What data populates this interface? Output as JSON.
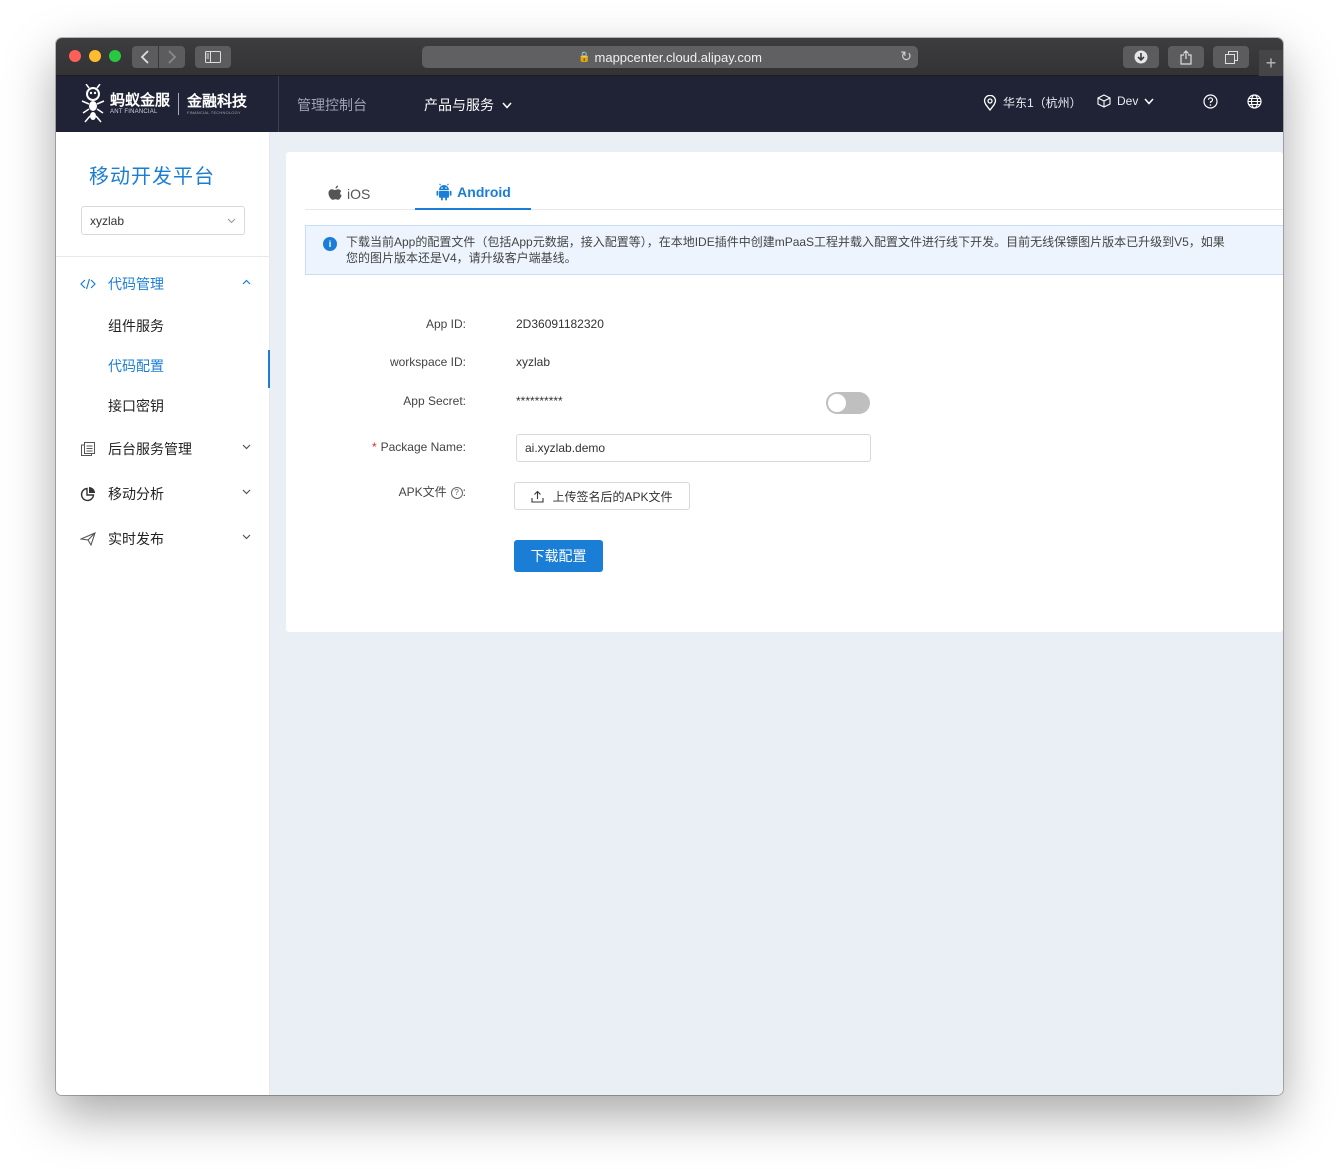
{
  "browser": {
    "url": "mappcenter.cloud.alipay.com"
  },
  "topnav": {
    "logo_brand": "蚂蚁金服",
    "logo_brand_sub": "ANT FINANCIAL",
    "logo_tagline": "金融科技",
    "logo_tagline_sub": "FINANCIAL TECHNOLOGY",
    "console_label": "管理控制台",
    "products_label": "产品与服务",
    "region_label": "华东1（杭州）",
    "env_label": "Dev"
  },
  "sidebar": {
    "platform_title": "移动开发平台",
    "workspace_value": "xyzlab",
    "groups": [
      {
        "label": "代码管理",
        "icon": "code-icon",
        "expanded": true
      },
      {
        "label": "后台服务管理",
        "icon": "file-copy-icon",
        "expanded": false
      },
      {
        "label": "移动分析",
        "icon": "pie-chart-icon",
        "expanded": false
      },
      {
        "label": "实时发布",
        "icon": "send-icon",
        "expanded": false
      }
    ],
    "code_subitems": [
      "组件服务",
      "代码配置",
      "接口密钥"
    ],
    "selected_subitem": "代码配置"
  },
  "main": {
    "tabs": [
      {
        "label": "iOS",
        "icon": "apple-icon",
        "active": false
      },
      {
        "label": "Android",
        "icon": "android-icon",
        "active": true
      }
    ],
    "alert_line1": "下载当前App的配置文件（包括App元数据，接入配置等），在本地IDE插件中创建mPaaS工程并载入配置文件进行线下开发。目前无线保镖图片版本已升级到V5，如果",
    "alert_line2": "您的图片版本还是V4，请升级客户端基线。",
    "form": {
      "app_id_label": "App ID:",
      "app_id_value": "2D36091182320",
      "workspace_id_label": "workspace ID:",
      "workspace_id_value": "xyzlab",
      "app_secret_label": "App Secret:",
      "app_secret_value": "**********",
      "app_secret_visible": false,
      "package_name_label": "Package Name:",
      "package_name_value": "ai.xyzlab.demo",
      "apk_label": "APK文件",
      "upload_button": "上传签名后的APK文件",
      "download_button": "下载配置"
    }
  },
  "colors": {
    "accent": "#1b7ed6",
    "topnav_bg": "#1f2335",
    "main_bg": "#eaeef5"
  }
}
